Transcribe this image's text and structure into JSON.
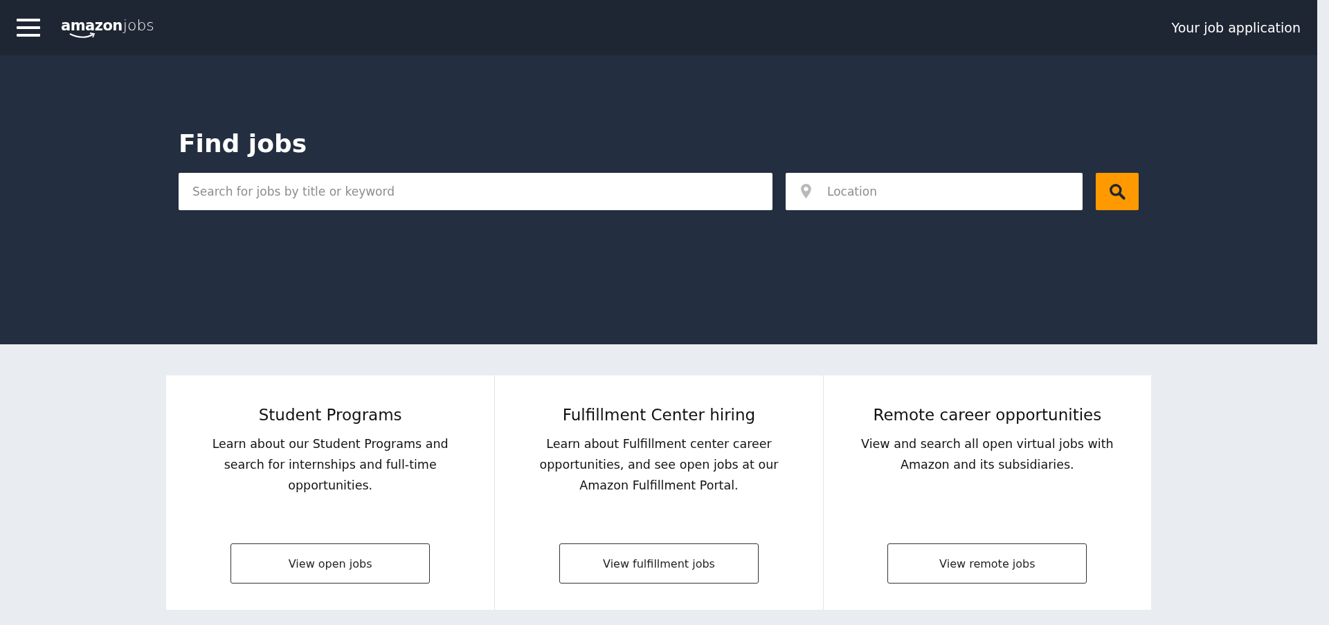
{
  "header": {
    "logo": {
      "brand": "amazon",
      "product": "jobs"
    },
    "link": "Your job application"
  },
  "hero": {
    "title": "Find jobs",
    "keyword_field": {
      "placeholder": "Search for jobs by title or keyword"
    },
    "location_field": {
      "placeholder": "Location"
    }
  },
  "cards": [
    {
      "title": "Student Programs",
      "text": "Learn about our Student Programs and search for internships and full-time opportunities.",
      "button": "View open jobs"
    },
    {
      "title": "Fulfillment Center hiring",
      "text": "Learn about Fulfillment center career opportunities, and see open jobs at our Amazon Fulfillment Portal.",
      "button": "View fulfillment jobs"
    },
    {
      "title": "Remote career opportunities",
      "text": "View and search all open virtual jobs with Amazon and its subsidiaries.",
      "button": "View remote jobs"
    }
  ]
}
